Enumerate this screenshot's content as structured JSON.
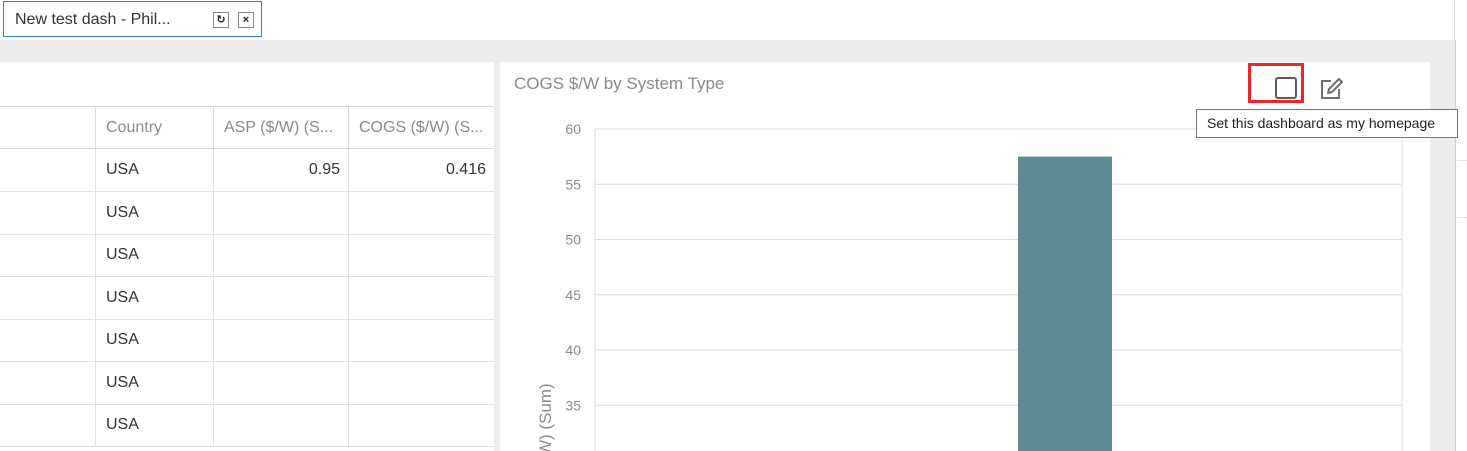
{
  "tab": {
    "title": "New test dash - Phil...",
    "refresh_glyph": "↻",
    "close_glyph": "×"
  },
  "table": {
    "columns": [
      "",
      "Country",
      "ASP ($/W) (S...",
      "COGS ($/W) (S..."
    ],
    "rows": [
      {
        "country": "USA",
        "asp": "0.95",
        "cogs": "0.416"
      },
      {
        "country": "USA",
        "asp": "",
        "cogs": ""
      },
      {
        "country": "USA",
        "asp": "",
        "cogs": ""
      },
      {
        "country": "USA",
        "asp": "",
        "cogs": ""
      },
      {
        "country": "USA",
        "asp": "",
        "cogs": ""
      },
      {
        "country": "USA",
        "asp": "",
        "cogs": ""
      },
      {
        "country": "USA",
        "asp": "",
        "cogs": ""
      }
    ]
  },
  "chart_panel": {
    "title": "COGS $/W by System Type",
    "tooltip": "Set this dashboard as my homepage",
    "homepage_icon": "checkbox-outline-icon",
    "edit_icon": "edit-icon",
    "highlight_color": "#e8262b"
  },
  "chart_data": {
    "type": "bar",
    "ylabel_visible": "W) (Sum)",
    "ylim": [
      30,
      60
    ],
    "yticks": [
      35,
      40,
      45,
      50,
      55,
      60
    ],
    "values": [
      57.5
    ],
    "bar_color": "#5f8b93",
    "grid": true
  }
}
